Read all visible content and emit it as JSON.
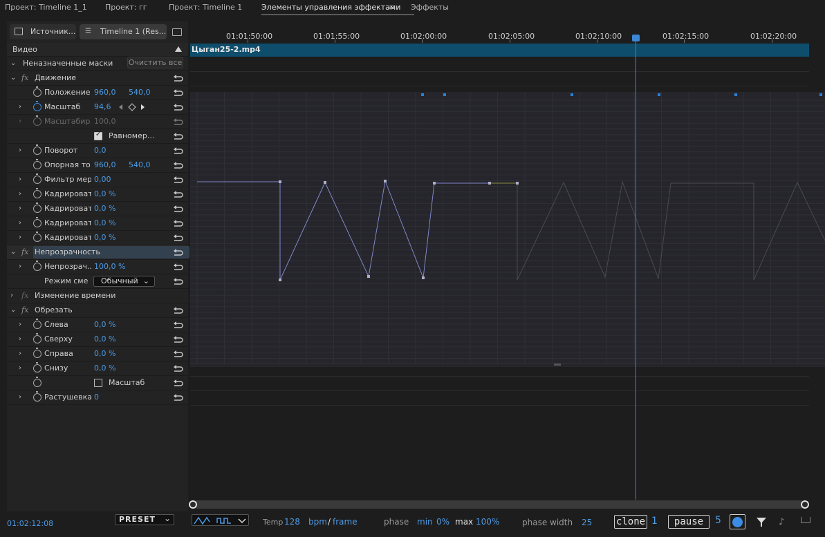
{
  "top_tabs": [
    {
      "label": "Проект: Timeline 1_1"
    },
    {
      "label": "Проект: гг"
    },
    {
      "label": "Проект: Timeline 1"
    },
    {
      "label": "Элементы управления эффектами"
    },
    {
      "label": "Эффекты"
    }
  ],
  "menu_glyph": "≡",
  "subtabs": {
    "source": "Источник...",
    "timeline": "Timeline 1 (Res..."
  },
  "panel": {
    "section": "Видео",
    "masks_label": "Неназначенные маски",
    "clear_all": "Очистить все",
    "motion": "Движение",
    "position": {
      "label": "Положение",
      "x": "960,0",
      "y": "540,0"
    },
    "scale": {
      "label": "Масштаб",
      "value": "94,6"
    },
    "scale_w": {
      "label": "Масштабир...",
      "value": "100,0"
    },
    "uniform": {
      "label": "Равномер..."
    },
    "rotation": {
      "label": "Поворот",
      "value": "0,0"
    },
    "anchor": {
      "label": "Опорная то...",
      "x": "960,0",
      "y": "540,0"
    },
    "flicker": {
      "label": "Фильтр мер...",
      "value": "0,00"
    },
    "crop1": {
      "label": "Кадрироват...",
      "value": "0,0 %"
    },
    "crop2": {
      "label": "Кадрироват...",
      "value": "0,0 %"
    },
    "crop3": {
      "label": "Кадрироват...",
      "value": "0,0 %"
    },
    "crop4": {
      "label": "Кадрироват...",
      "value": "0,0 %"
    },
    "opacity_section": "Непрозрачность",
    "opacity": {
      "label": "Непрозрач...",
      "value": "100,0 %"
    },
    "blend": {
      "label": "Режим сме...",
      "value": "Обычный"
    },
    "time_remap": "Изменение времени",
    "crop_section": "Обрезать",
    "left": {
      "label": "Слева",
      "value": "0,0 %"
    },
    "top": {
      "label": "Сверху",
      "value": "0,0 %"
    },
    "right": {
      "label": "Справа",
      "value": "0,0 %"
    },
    "bottom": {
      "label": "Снизу",
      "value": "0,0 %"
    },
    "crop_zoom": {
      "label": "Масштаб"
    },
    "feather": {
      "label": "Растушевка ...",
      "value": "0"
    }
  },
  "ruler": {
    "ticks": [
      "01:01:50:00",
      "01:01:55:00",
      "01:02:00:00",
      "01:02:05:00",
      "01:02:10:00",
      "01:02:15:00",
      "01:02:20:00"
    ]
  },
  "clip_name": "Цыган25-2.mp4",
  "timecode": "01:02:12:08",
  "bottom": {
    "preset": "PRESET",
    "temp_label": "Temp",
    "temp_value": "128",
    "unit_bpm": "bpm",
    "unit_slash": "/",
    "unit_frame": "frame",
    "phase_label": "phase",
    "min_label": "min",
    "min_value": "0%",
    "max_label": "max",
    "max_value": "100%",
    "phase_width_label": "phase width",
    "phase_width_value": "25",
    "clone_label": "clone",
    "clone_value": "1",
    "pause_label": "pause",
    "pause_value": "5"
  },
  "colors": {
    "accent": "#4d9be6",
    "clip": "#0e4e6c",
    "playhead": "#3b87d6"
  }
}
